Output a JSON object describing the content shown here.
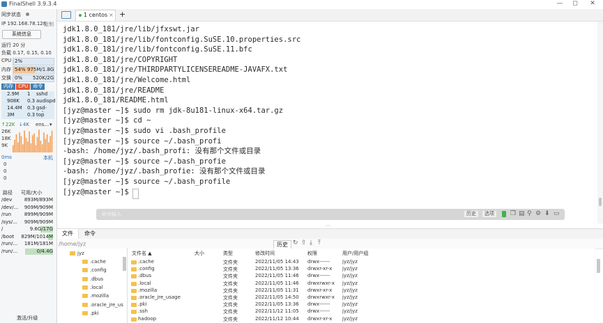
{
  "window": {
    "title": "FinalShell 3.9.3.4",
    "controls": [
      "—",
      "◻",
      "✕"
    ]
  },
  "sidebar": {
    "sync_status_label": "同步状态",
    "ip_label": "IP 192.168.78.128",
    "copy_label": "复制",
    "sysinfo_button": "系统信息",
    "uptime": "运行 20 分",
    "load": "负载 0.17, 0.15, 0.10",
    "cpu_label": "CPU",
    "cpu_value": "2%",
    "cpu_fraction": 0.02,
    "mem_label": "内存",
    "mem_percent": "54%",
    "mem_value": "975M/1.8G",
    "mem_fraction": 0.54,
    "swap_label": "交换",
    "swap_percent": "0%",
    "swap_value": "520K/2G",
    "proc_tabs": [
      "内存",
      "CPU",
      "命令"
    ],
    "processes": [
      {
        "mem": "2.9M",
        "cpu": "1",
        "name": "sshd"
      },
      {
        "mem": "908K",
        "cpu": "0.3",
        "name": "audispd"
      },
      {
        "mem": "14.4M",
        "cpu": "0.3",
        "name": "gsd-colo"
      },
      {
        "mem": "3M",
        "cpu": "0.3",
        "name": "top"
      }
    ],
    "net_up": "↑22K",
    "net_down": "↓4K",
    "net_iface": "ens...",
    "net_scale": [
      "26K",
      "18K",
      "9K"
    ],
    "net_series": [
      8,
      14,
      20,
      11,
      22,
      18,
      9,
      24,
      16,
      12,
      23,
      10,
      19,
      21,
      8,
      17,
      25,
      13,
      9,
      22,
      15,
      20,
      11,
      18,
      24
    ],
    "ping_label": "0ms",
    "ping_host": "本机",
    "ping_values": [
      "0",
      "0",
      "0"
    ],
    "disk_headers": [
      "路径",
      "可用/大小"
    ],
    "disks": [
      {
        "path": "/dev",
        "size": "893M/893M",
        "fraction": 0.0
      },
      {
        "path": "/dev/...",
        "size": "909M/909M",
        "fraction": 0.0
      },
      {
        "path": "/run",
        "size": "899M/909M",
        "fraction": 0.01
      },
      {
        "path": "/sys/...",
        "size": "909M/909M",
        "fraction": 0.0
      },
      {
        "path": "/",
        "size": "9.6G/17G",
        "fraction": 0.44
      },
      {
        "path": "/boot",
        "size": "829M/1014M",
        "fraction": 0.18
      },
      {
        "path": "/run/...",
        "size": "181M/181M",
        "fraction": 0.0
      },
      {
        "path": "/run/...",
        "size": "0/4.4G",
        "fraction": 1.0
      }
    ],
    "activate_label": "激活/升级"
  },
  "tabs": {
    "active_tab": "1 centos",
    "close": "×",
    "add": "+"
  },
  "terminal": {
    "lines": [
      "jdk1.8.0_181/jre/lib/jfxswt.jar",
      "jdk1.8.0_181/jre/lib/fontconfig.SuSE.10.properties.src",
      "jdk1.8.0_181/jre/lib/fontconfig.SuSE.11.bfc",
      "jdk1.8.0_181/jre/COPYRIGHT",
      "jdk1.8.0_181/jre/THIRDPARTYLICENSEREADME-JAVAFX.txt",
      "jdk1.8.0_181/jre/Welcome.html",
      "jdk1.8.0_181/jre/README",
      "jdk1.8.0_181/README.html",
      "[jyz@master ~]$ sudo rm jdk-8u181-linux-x64.tar.gz",
      "[jyz@master ~]$ cd ~",
      "[jyz@master ~]$ sudo vi .bash_profile",
      "[jyz@master ~]$ source ~/.bash_profi",
      "-bash: /home/jyz/.bash_profi: 没有那个文件或目录",
      "[jyz@master ~]$ source ~/.bash_profie",
      "-bash: /home/jyz/.bash_profie: 没有那个文件或目录",
      "[jyz@master ~]$ source ~/.bash_profile",
      "[jyz@master ~]$ "
    ],
    "cmd_placeholder": "命令输入",
    "history_button": "历史",
    "options_button": "选项"
  },
  "files": {
    "tabs": [
      "文件",
      "命令"
    ],
    "path": "/home/jyz",
    "history_button": "历史",
    "tree_root": "jyz",
    "tree_items": [
      ".cache",
      ".config",
      ".dbus",
      ".local",
      ".mozilla",
      ".oracle_jre_us",
      ".pki"
    ],
    "columns": [
      "文件名 ▲",
      "大小",
      "类型",
      "修改时间",
      "权限",
      "用户/用户组"
    ],
    "rows": [
      {
        "name": ".cache",
        "size": "",
        "type": "文件夹",
        "time": "2022/11/05 14:43",
        "perm": "drwx------",
        "owner": "jyz/jyz"
      },
      {
        "name": ".config",
        "size": "",
        "type": "文件夹",
        "time": "2022/11/05 13:36",
        "perm": "drwxr-xr-x",
        "owner": "jyz/jyz"
      },
      {
        "name": ".dbus",
        "size": "",
        "type": "文件夹",
        "time": "2022/11/05 11:46",
        "perm": "drwx------",
        "owner": "jyz/jyz"
      },
      {
        "name": ".local",
        "size": "",
        "type": "文件夹",
        "time": "2022/11/05 11:46",
        "perm": "drwxrwxr-x",
        "owner": "jyz/jyz"
      },
      {
        "name": ".mozilla",
        "size": "",
        "type": "文件夹",
        "time": "2022/11/05 11:31",
        "perm": "drwxr-xr-x",
        "owner": "jyz/jyz"
      },
      {
        "name": ".oracle_jre_usage",
        "size": "",
        "type": "文件夹",
        "time": "2022/11/05 14:50",
        "perm": "drwxrwxr-x",
        "owner": "jyz/jyz"
      },
      {
        "name": ".pki",
        "size": "",
        "type": "文件夹",
        "time": "2022/11/05 13:36",
        "perm": "drwx------",
        "owner": "jyz/jyz"
      },
      {
        "name": ".ssh",
        "size": "",
        "type": "文件夹",
        "time": "2022/11/12 11:05",
        "perm": "drwx------",
        "owner": "jyz/jyz"
      },
      {
        "name": "hadoop",
        "size": "",
        "type": "文件夹",
        "time": "2022/11/12 10:44",
        "perm": "drwxr-xr-x",
        "owner": "jyz/jyz"
      }
    ]
  },
  "colors": {
    "accent": "#3c7fb1",
    "cpu_tab": "#e05a3a",
    "net_graph": "#f3a35c",
    "folder": "#f3c24e"
  }
}
